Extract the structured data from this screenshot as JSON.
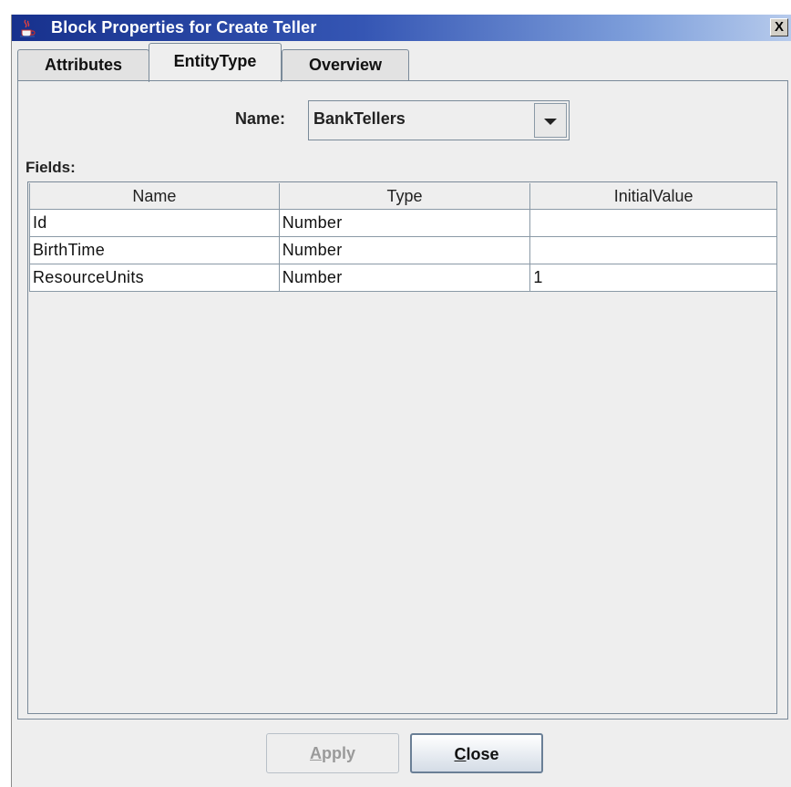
{
  "window": {
    "title": "Block Properties for Create Teller",
    "close_glyph": "X",
    "title_icon": "java-cup-icon"
  },
  "tabs": [
    {
      "label": "Attributes",
      "selected": false
    },
    {
      "label": "EntityType",
      "selected": true
    },
    {
      "label": "Overview",
      "selected": false
    }
  ],
  "entity": {
    "name_label": "Name:",
    "name_value": "BankTellers"
  },
  "fields": {
    "label": "Fields:",
    "columns": [
      "Name",
      "Type",
      "InitialValue"
    ],
    "rows": [
      [
        "Id",
        "Number",
        ""
      ],
      [
        "BirthTime",
        "Number",
        ""
      ],
      [
        "ResourceUnits",
        "Number",
        "1"
      ]
    ]
  },
  "buttons": {
    "apply_mnemonic": "A",
    "apply_rest": "pply",
    "close_mnemonic": "C",
    "close_rest": "lose"
  }
}
